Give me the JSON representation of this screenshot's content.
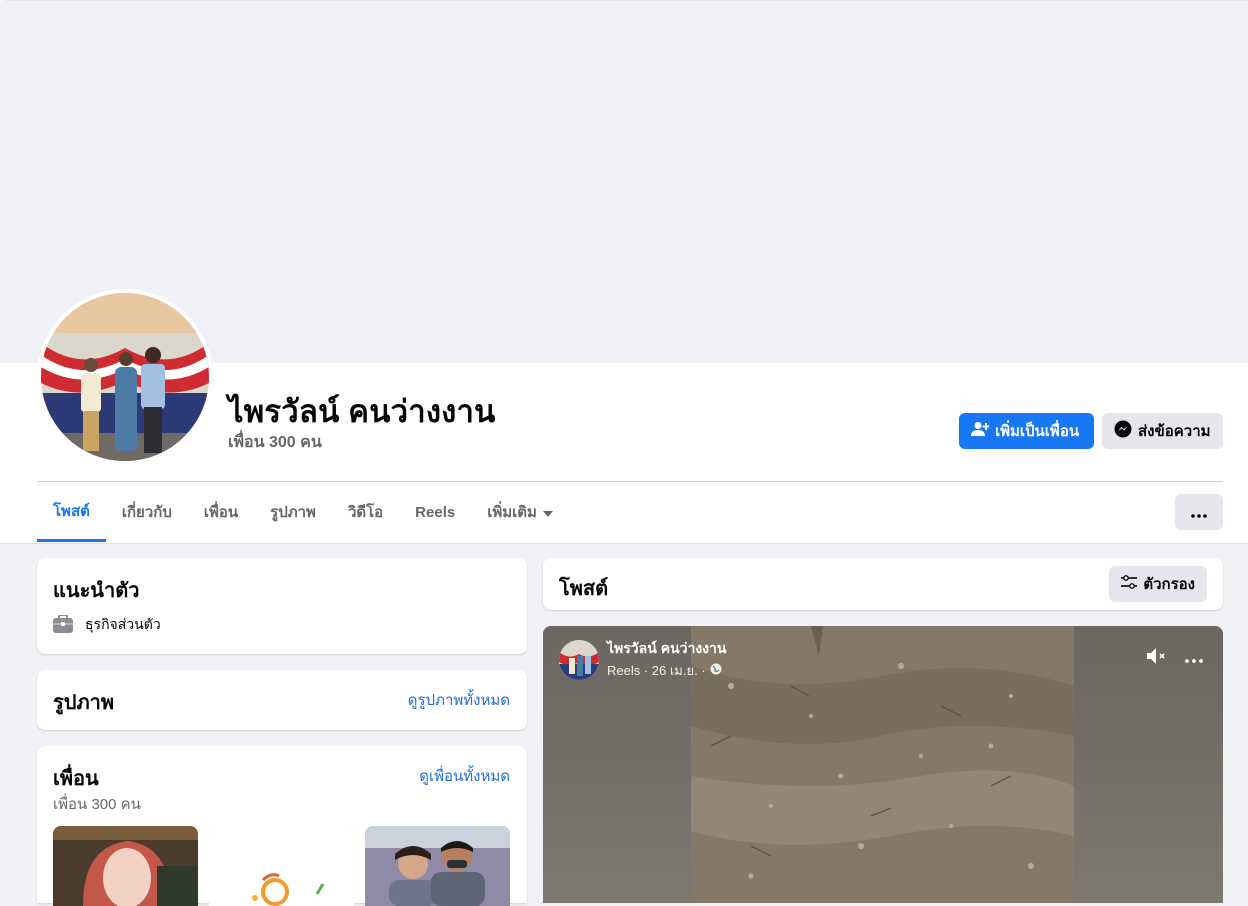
{
  "profile": {
    "name": "ไพรวัลน์ คนว่างงาน",
    "friends_count": "เพื่อน 300 คน"
  },
  "actions": {
    "add_friend": "เพิ่มเป็นเพื่อน",
    "message": "ส่งข้อความ"
  },
  "tabs": [
    {
      "label": "โพสต์",
      "active": true
    },
    {
      "label": "เกี่ยวกับ"
    },
    {
      "label": "เพื่อน"
    },
    {
      "label": "รูปภาพ"
    },
    {
      "label": "วิดีโอ"
    },
    {
      "label": "Reels"
    },
    {
      "label": "เพิ่มเติม"
    }
  ],
  "intro": {
    "title": "แนะนำตัว",
    "item": "ธุรกิจส่วนตัว"
  },
  "photos": {
    "title": "รูปภาพ",
    "see_all": "ดูรูปภาพทั้งหมด"
  },
  "friends": {
    "title": "เพื่อน",
    "see_all": "ดูเพื่อนทั้งหมด",
    "count": "เพื่อน 300 คน"
  },
  "posts": {
    "title": "โพสต์",
    "filter": "ตัวกรอง"
  },
  "reel": {
    "author": "ไพรวัลน์ คนว่างงาน",
    "meta": "Reels · 26 เม.ย. ·"
  },
  "colors": {
    "primary": "#1877f2",
    "link": "#216fdb",
    "secondary_text": "#65676b"
  }
}
